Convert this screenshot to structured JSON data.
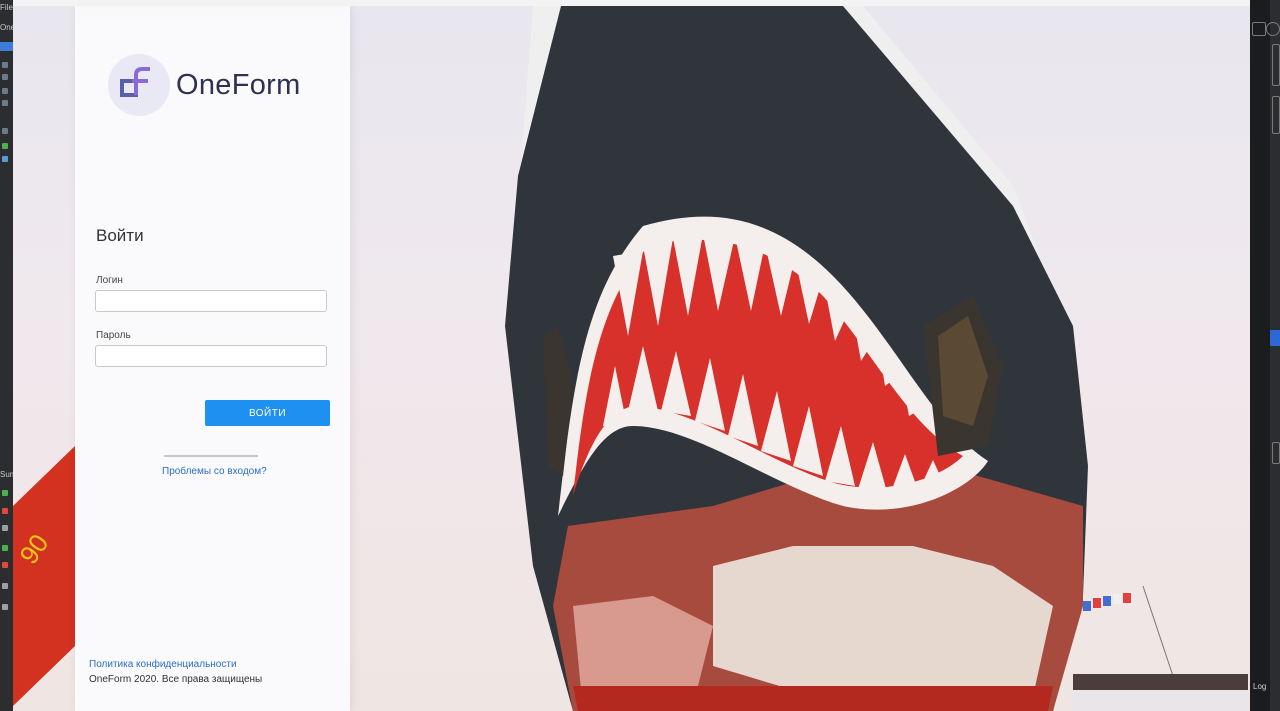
{
  "brand": {
    "name": "OneForm"
  },
  "login": {
    "title": "Войти",
    "username_label": "Логин",
    "username_value": "",
    "password_label": "Пароль",
    "password_value": "",
    "submit_label": "ВОЙТИ",
    "trouble_link": "Проблемы со входом?"
  },
  "footer": {
    "privacy_link": "Политика конфиденциальности",
    "copyright": "OneForm 2020. Все права защищены"
  },
  "ide": {
    "top_left_labels": [
      "File",
      "One"
    ],
    "left_label_2": "Sum",
    "right_bottom_label": "Log"
  },
  "colors": {
    "brand_text": "#2e3151",
    "logo_mark": "#5b5fa8",
    "logo_accent": "#8a6ad9",
    "primary_button": "#1e90f0",
    "link": "#2a6fc7",
    "hull": "#2a2f35",
    "teeth_red": "#d8302a"
  },
  "icons": {
    "logo": "oneform-logo-icon"
  }
}
